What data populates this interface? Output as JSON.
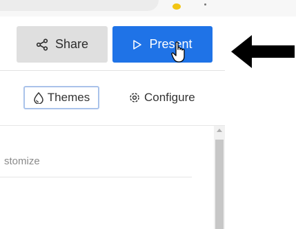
{
  "toolbar": {
    "share_label": "Share",
    "present_label": "Present"
  },
  "tabs": [
    {
      "label": "Themes",
      "active": true
    },
    {
      "label": "Configure",
      "active": false
    }
  ],
  "panel": {
    "customize_text": "stomize"
  },
  "icons": {
    "share": "share-icon",
    "present": "play-outline-icon",
    "themes": "droplet-icon",
    "configure": "gear-icon",
    "annotation": "left-arrow-icon",
    "cursor": "hand-pointer-icon"
  },
  "colors": {
    "present_bg": "#1f73e7",
    "share_bg": "#dfdfdf",
    "themes_border": "#a9c2ea",
    "avatar": "#f2c514"
  }
}
